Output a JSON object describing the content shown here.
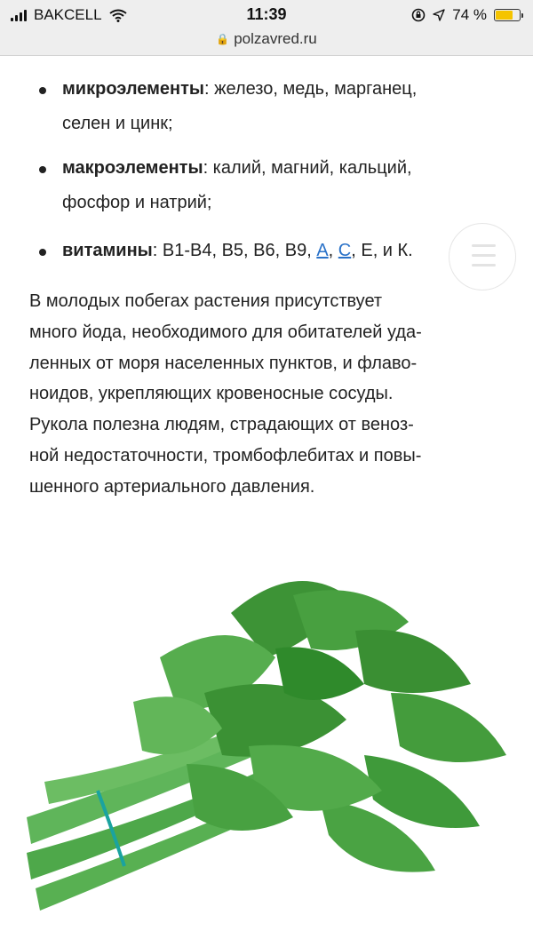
{
  "status_bar": {
    "carrier": "BAKCELL",
    "time": "11:39",
    "battery_percent": "74 %",
    "battery_level": 0.74,
    "url": "polzavred.ru",
    "icons": [
      "signal-icon",
      "wifi-icon",
      "lock-icon",
      "orientation-lock-icon",
      "location-arrow-icon",
      "battery-icon"
    ]
  },
  "list": {
    "items": [
      {
        "label": "микроэлементы",
        "line1": ": железо, медь, марганец,",
        "line2": "селен и цинк;"
      },
      {
        "label": "макроэлементы",
        "line1": ": калий, магний, кальций,",
        "line2": "фосфор и натрий;"
      },
      {
        "label": "витамины",
        "text_a": ": В1-В4, В5, В6, В9, ",
        "link_a": "А",
        "sep": ", ",
        "link_c": "С",
        "text_end": ", Е, и К."
      }
    ]
  },
  "paragraph": {
    "lines": [
      "В молодых побегах растения присутствует",
      "много йода, необходимого для обитателей уда-",
      "ленных от моря населенных пунктов, и флаво-",
      "ноидов, укрепляющих кровеносные сосуды.",
      "Рукола полезна людям, страдающих от веноз-",
      "ной недостаточности, тромбофлебитах и повы-",
      "шенного артериального давления."
    ]
  },
  "colors": {
    "link": "#2a72c8",
    "battery": "#f5c400",
    "leaf": "#3f9a3a",
    "band": "#1aa3a0"
  },
  "image": {
    "subject": "arugula bunch"
  }
}
